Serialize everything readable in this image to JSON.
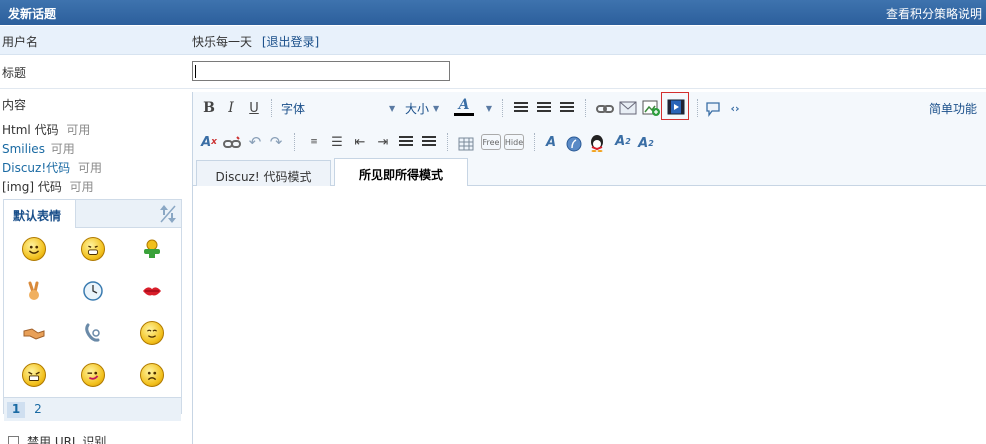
{
  "header": {
    "title": "发新话题",
    "help_link": "查看积分策略说明"
  },
  "user": {
    "label": "用户名",
    "name": "快乐每一天",
    "logout": "[退出登录]"
  },
  "subject": {
    "label": "标题",
    "value": ""
  },
  "content": {
    "label": "内容",
    "html": {
      "name": "Html 代码",
      "status": "可用"
    },
    "smilies": {
      "name": "Smilies",
      "status": "可用"
    },
    "discuz": {
      "name": "Discuz!代码",
      "status": "可用"
    },
    "img": {
      "name": "[img] 代码",
      "status": "可用"
    }
  },
  "smilies_panel": {
    "tab": "默认表情",
    "icons": [
      "smile-icon",
      "grin-icon",
      "hug-icon",
      "victory-icon",
      "clock-icon",
      "lips-icon",
      "handshake-icon",
      "phone-icon",
      "shy-icon",
      "cry-icon",
      "wink-icon",
      "sad-icon"
    ],
    "pages": [
      "1",
      "2"
    ],
    "current_page": "1"
  },
  "options": {
    "disable_url_label": "禁用 URL 识别"
  },
  "toolbar": {
    "bold": "B",
    "italic": "I",
    "underline": "U",
    "font": "字体",
    "size": "大小",
    "color": "A",
    "simple_mode": "简单功能",
    "free": "Free",
    "hide": "Hide",
    "sup": "A",
    "sub": "A"
  },
  "mode_tabs": {
    "code": "Discuz! 代码模式",
    "wysiwyg": "所见即所得模式"
  },
  "colors": {
    "header": "#2c5f9c",
    "link": "#1a4f8a",
    "highlight": "#d32f2f"
  }
}
